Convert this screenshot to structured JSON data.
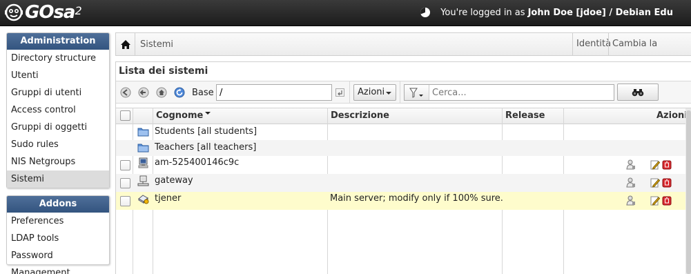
{
  "header": {
    "logo_text": "GOsa",
    "logo_sup": "2",
    "session_prefix": "You're logged in as",
    "session_user": "John Doe [jdoe] / Debian Edu"
  },
  "sidebar": {
    "admin_title": "Administration",
    "admin_items": [
      {
        "label": "Directory structure",
        "active": false
      },
      {
        "label": "Utenti",
        "active": false
      },
      {
        "label": "Gruppi di utenti",
        "active": false
      },
      {
        "label": "Access control",
        "active": false
      },
      {
        "label": "Gruppi di oggetti",
        "active": false
      },
      {
        "label": "Sudo rules",
        "active": false
      },
      {
        "label": "NIS Netgroups",
        "active": false
      },
      {
        "label": "Sistemi",
        "active": true
      }
    ],
    "addons_title": "Addons",
    "addons_items": [
      {
        "label": "Preferences"
      },
      {
        "label": "LDAP tools"
      },
      {
        "label": "Password Management"
      }
    ]
  },
  "breadcrumb": {
    "current": "Sistemi",
    "right_links": [
      "Identità",
      "Cambia la password"
    ]
  },
  "list": {
    "title": "Lista dei sistemi",
    "base_label": "Base",
    "base_value": "/",
    "actions_label": "Azioni",
    "search_placeholder": "Cerca...",
    "columns": [
      "Cognome",
      "Descrizione",
      "Release",
      "Azioni"
    ],
    "sort_column": "Cognome",
    "rows": [
      {
        "name": "Students [all students]",
        "description": "",
        "release": "",
        "icon": "folder-icon",
        "checkbox": false,
        "actions": false
      },
      {
        "name": "Teachers [all teachers]",
        "description": "",
        "release": "",
        "icon": "folder-icon",
        "checkbox": false,
        "actions": false
      },
      {
        "name": "am-525400146c9c",
        "description": "",
        "release": "",
        "icon": "workstation-icon",
        "checkbox": true,
        "actions": true
      },
      {
        "name": "gateway",
        "description": "",
        "release": "",
        "icon": "terminal-icon",
        "checkbox": true,
        "actions": true
      },
      {
        "name": "tjener",
        "description": "Main server; modify only if 100% sure.",
        "release": "",
        "icon": "server-icon",
        "checkbox": true,
        "actions": true,
        "highlighted": true
      }
    ]
  },
  "colors": {
    "menu_header": "#3d5e8a",
    "topbar": "#2a2a2a",
    "row_highlight": "#fefccc",
    "active_menu": "#dcdcdc"
  }
}
